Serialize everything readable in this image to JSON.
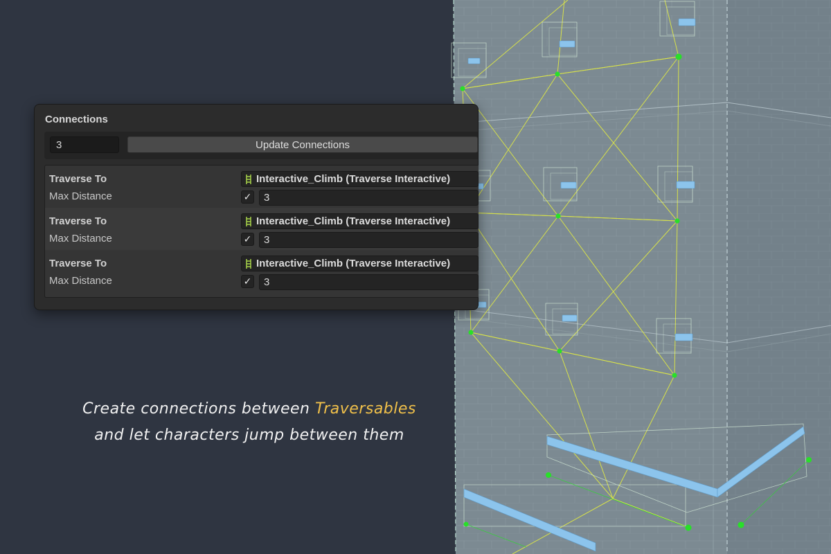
{
  "panel": {
    "title": "Connections",
    "count_value": "3",
    "update_button_label": "Update Connections",
    "rows": [
      {
        "traverse_label": "Traverse To",
        "target": "Interactive_Climb (Traverse Interactive)",
        "max_distance_label": "Max Distance",
        "enabled": "✓",
        "max_distance": "3"
      },
      {
        "traverse_label": "Traverse To",
        "target": "Interactive_Climb (Traverse Interactive)",
        "max_distance_label": "Max Distance",
        "enabled": "✓",
        "max_distance": "3"
      },
      {
        "traverse_label": "Traverse To",
        "target": "Interactive_Climb (Traverse Interactive)",
        "max_distance_label": "Max Distance",
        "enabled": "✓",
        "max_distance": "3"
      }
    ]
  },
  "caption": {
    "line1_prefix": "Create connections between ",
    "line1_highlight": "Traversables",
    "line2": "and let characters jump between them"
  },
  "colors": {
    "background": "#2f3541",
    "building": "#7c8a92",
    "connection_line": "#d8e24a",
    "node": "#28e028",
    "handle": "#8cc4ec",
    "highlight": "#f0c04a",
    "ladder_icon": "#a8d44a"
  },
  "icons": {
    "target_field": "ladder-icon",
    "checkbox": "checkmark-icon"
  }
}
